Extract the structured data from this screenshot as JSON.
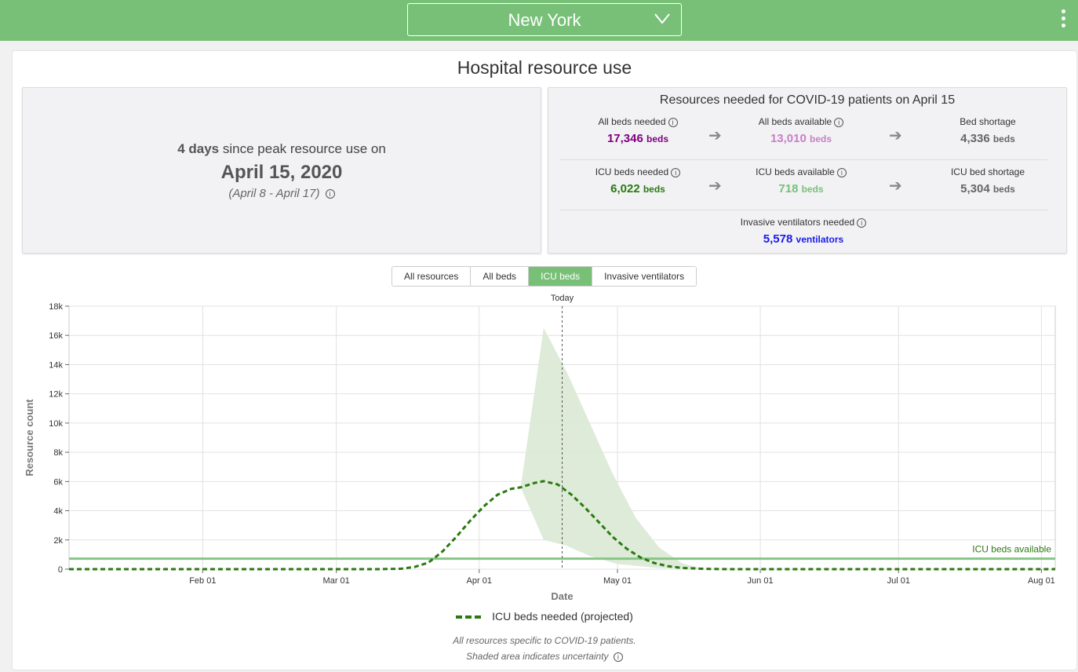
{
  "header": {
    "location": "New York"
  },
  "card": {
    "title": "Hospital resource use"
  },
  "peak": {
    "days": "4 days",
    "since_text": "since peak resource use on",
    "date": "April 15, 2020",
    "range": "(April 8 - April 17)"
  },
  "resources": {
    "title": "Resources needed for COVID-19 patients on April 15",
    "beds_needed": {
      "label": "All beds needed",
      "value": "17,346",
      "unit": "beds",
      "color": "#800080"
    },
    "beds_available": {
      "label": "All beds available",
      "value": "13,010",
      "unit": "beds",
      "color": "#c87fc8"
    },
    "bed_shortage": {
      "label": "Bed shortage",
      "value": "4,336",
      "unit": "beds",
      "color": "#666666"
    },
    "icu_needed": {
      "label": "ICU beds needed",
      "value": "6,022",
      "unit": "beds",
      "color": "#2a7a10"
    },
    "icu_available": {
      "label": "ICU beds available",
      "value": "718",
      "unit": "beds",
      "color": "#78c078"
    },
    "icu_shortage": {
      "label": "ICU bed shortage",
      "value": "5,304",
      "unit": "beds",
      "color": "#666666"
    },
    "vent_needed": {
      "label": "Invasive ventilators needed",
      "value": "5,578",
      "unit": "ventilators",
      "color": "#1a1aee"
    }
  },
  "tabs": [
    "All resources",
    "All beds",
    "ICU beds",
    "Invasive ventilators"
  ],
  "active_tab": 2,
  "footer": {
    "line1": "All resources specific to COVID-19 patients.",
    "line2": "Shaded area indicates uncertainty"
  },
  "colors": {
    "topbar": "#78c078",
    "projection": "#2a7a10",
    "uncertainty": "#dbead6",
    "available": "#86c686"
  },
  "chart_data": {
    "type": "line",
    "xlabel": "Date",
    "ylabel": "Resource count",
    "x_ticks": [
      "Feb 01",
      "Mar 01",
      "Apr 01",
      "May 01",
      "Jun 01",
      "Jul 01",
      "Aug 01"
    ],
    "y_ticks": [
      "0",
      "2k",
      "4k",
      "6k",
      "8k",
      "10k",
      "12k",
      "14k",
      "16k",
      "18k"
    ],
    "ylim": [
      0,
      18000
    ],
    "xlim": [
      "2020-01-03",
      "2020-08-04"
    ],
    "today": {
      "label": "Today",
      "date": "2020-04-19"
    },
    "grid": true,
    "legend": "bottom-center",
    "series": [
      {
        "name": "ICU beds needed (projected)",
        "style": "dashed",
        "points": [
          [
            "2020-01-03",
            0
          ],
          [
            "2020-03-10",
            0
          ],
          [
            "2020-03-15",
            30
          ],
          [
            "2020-03-18",
            150
          ],
          [
            "2020-03-21",
            450
          ],
          [
            "2020-03-24",
            1200
          ],
          [
            "2020-03-27",
            2200
          ],
          [
            "2020-03-30",
            3300
          ],
          [
            "2020-04-02",
            4300
          ],
          [
            "2020-04-05",
            5100
          ],
          [
            "2020-04-08",
            5500
          ],
          [
            "2020-04-10",
            5600
          ],
          [
            "2020-04-13",
            5900
          ],
          [
            "2020-04-15",
            6022
          ],
          [
            "2020-04-18",
            5800
          ],
          [
            "2020-04-21",
            5100
          ],
          [
            "2020-04-24",
            4200
          ],
          [
            "2020-04-27",
            3200
          ],
          [
            "2020-04-30",
            2200
          ],
          [
            "2020-05-03",
            1400
          ],
          [
            "2020-05-06",
            800
          ],
          [
            "2020-05-09",
            420
          ],
          [
            "2020-05-12",
            200
          ],
          [
            "2020-05-15",
            80
          ],
          [
            "2020-05-20",
            20
          ],
          [
            "2020-05-25",
            0
          ],
          [
            "2020-08-04",
            0
          ]
        ]
      }
    ],
    "uncertainty_band": {
      "upper": [
        [
          "2020-04-10",
          5600
        ],
        [
          "2020-04-15",
          16500
        ],
        [
          "2020-04-20",
          13500
        ],
        [
          "2020-04-25",
          10000
        ],
        [
          "2020-04-30",
          6500
        ],
        [
          "2020-05-05",
          3500
        ],
        [
          "2020-05-10",
          1500
        ],
        [
          "2020-05-15",
          400
        ],
        [
          "2020-05-20",
          0
        ]
      ],
      "lower": [
        [
          "2020-05-20",
          0
        ],
        [
          "2020-05-10",
          80
        ],
        [
          "2020-05-01",
          350
        ],
        [
          "2020-04-25",
          900
        ],
        [
          "2020-04-20",
          1600
        ],
        [
          "2020-04-15",
          2000
        ],
        [
          "2020-04-10",
          5600
        ]
      ]
    },
    "reference_lines": [
      {
        "label": "ICU beds available",
        "value": 718
      }
    ]
  }
}
